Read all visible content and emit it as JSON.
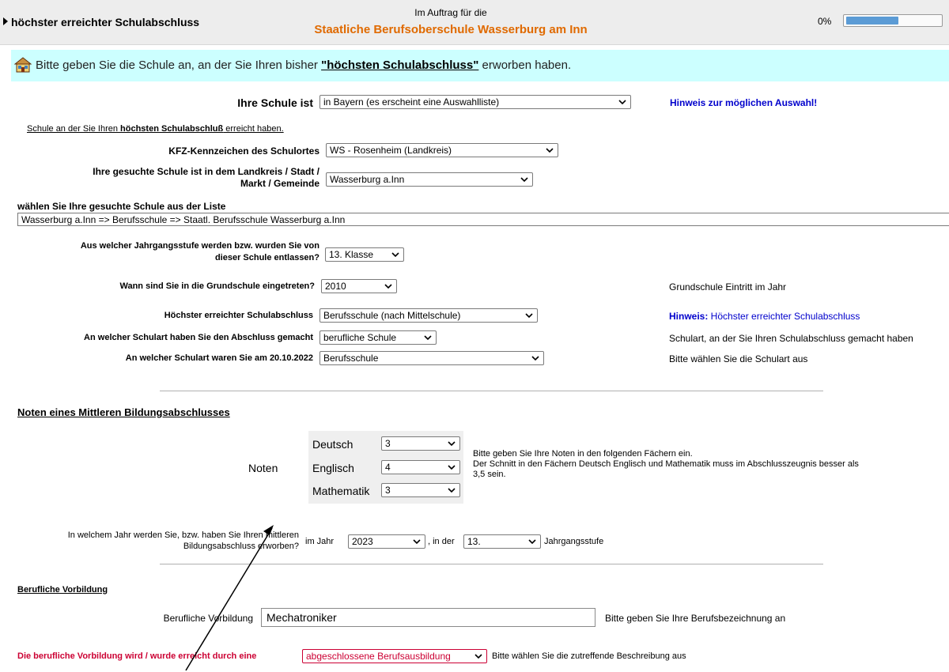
{
  "header": {
    "section_title": "höchster erreichter Schulabschluss",
    "commission_prefix": "Im Auftrag für die",
    "school_name": "Staatliche Berufsoberschule Wasserburg am Inn",
    "progress_text": "0%",
    "progress_value": 0
  },
  "instruction": {
    "text_before": "Bitte geben Sie die Schule an, an der Sie Ihren bisher ",
    "text_highlight": "\"höchsten Schulabschluss\"",
    "text_after": " erworben haben."
  },
  "school": {
    "label": "Ihre Schule ist",
    "value": "in Bayern (es erscheint eine Auswahlliste)",
    "hint_link": "Hinweis zur möglichen Auswahl!",
    "subnote_before": "Schule an der Sie Ihren ",
    "subnote_bold": "höchsten Schulabschluß",
    "subnote_after": " erreicht haben.",
    "kfz_label": "KFZ-Kennzeichen des Schulortes",
    "kfz_value": "WS - Rosenheim (Landkreis)",
    "district_label_1": "Ihre gesuchte Schule ist in dem Landkreis / Stadt /",
    "district_label_2": "Markt / Gemeinde",
    "district_value": "Wasserburg a.Inn",
    "list_label": "wählen Sie Ihre gesuchte Schule aus der Liste",
    "list_value": "Wasserburg a.Inn => Berufsschule => Staatl. Berufsschule Wasserburg a.Inn"
  },
  "education": {
    "grade_label_1": "Aus welcher Jahrgangsstufe werden bzw. wurden Sie von",
    "grade_label_2": "dieser Schule entlassen?",
    "grade_value": "13. Klasse",
    "primary_label": "Wann sind Sie in die Grundschule eingetreten?",
    "primary_value": "2010",
    "primary_note": "Grundschule Eintritt im Jahr",
    "highest_label": "Höchster erreichter Schulabschluss",
    "highest_value": "Berufsschule (nach Mittelschule)",
    "highest_hint_bold": "Hinweis:",
    "highest_hint_text": " Höchster erreichter Schulabschluss",
    "type_label": "An welcher Schulart haben Sie den Abschluss gemacht",
    "type_value": "berufliche Schule",
    "type_note": "Schulart, an der Sie Ihren Schulabschluss gemacht haben",
    "date_label": "An welcher Schulart waren Sie am 20.10.2022",
    "date_value": "Berufsschule",
    "date_note": "Bitte wählen Sie die Schulart aus"
  },
  "grades": {
    "section_title": "Noten eines Mittleren Bildungsabschlusses",
    "label": "Noten",
    "subjects": [
      {
        "name": "Deutsch",
        "value": "3"
      },
      {
        "name": "Englisch",
        "value": "4"
      },
      {
        "name": "Mathematik",
        "value": "3"
      }
    ],
    "note_line1": "Bitte geben Sie Ihre Noten in den folgenden Fächern ein.",
    "note_line2": "Der Schnitt in den Fächern Deutsch Englisch und Mathematik muss im Abschlusszeugnis besser als",
    "note_line3": "3,5 sein.",
    "year_question_1": "In welchem Jahr werden Sie, bzw. haben Sie Ihren mittleren",
    "year_question_2": "Bildungsabschluss erworben?",
    "year_prefix": "im Jahr",
    "year_value": "2023",
    "in_der": ", in der",
    "level_value": "13.",
    "level_suffix": "Jahrgangsstufe"
  },
  "vocational": {
    "section_title": "Berufliche Vorbildung",
    "label": "Berufliche Vorbildung",
    "value": "Mechatroniker",
    "note": "Bitte geben Sie Ihre Berufsbezeichnung an",
    "achieved_label": "Die berufliche Vorbildung wird / wurde erreicht durch eine",
    "achieved_value": "abgeschlossene Berufsausbildung",
    "achieved_note": "Bitte wählen Sie die zutreffende Beschreibung aus"
  },
  "colors": {
    "accent_orange": "#e06a00",
    "link_blue": "#0000cc",
    "required_red": "#cc0033",
    "info_bar": "#ccffff",
    "progress_blue": "#5b9bd5"
  }
}
